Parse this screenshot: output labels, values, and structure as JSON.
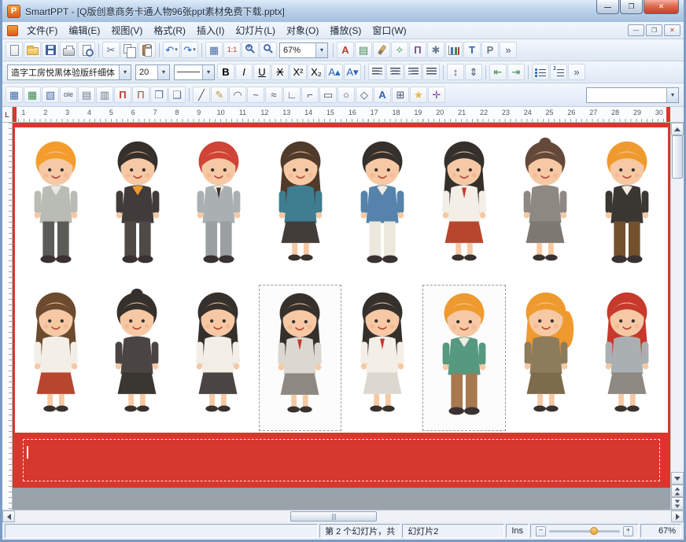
{
  "window": {
    "title": "SmartPPT - [Q版创意商务卡通人物96张ppt素材免费下载.pptx]"
  },
  "menu": {
    "items": [
      "文件(F)",
      "编辑(E)",
      "视图(V)",
      "格式(R)",
      "插入(I)",
      "幻灯片(L)",
      "对象(O)",
      "播放(S)",
      "窗口(W)"
    ]
  },
  "toolbars": {
    "zoom_combo": "67%",
    "font_combo": "造字工房悦黑体验版纤细体",
    "size_combo": "20",
    "row1_a": [
      {
        "name": "new-document-icon",
        "cls": "ic-page"
      },
      {
        "name": "open-folder-icon",
        "cls": "ic-folder"
      },
      {
        "name": "save-icon",
        "cls": "ic-disk"
      },
      {
        "name": "print-icon",
        "cls": "ic-print"
      },
      {
        "name": "print-preview-icon",
        "cls": "ic-preview"
      },
      {
        "sep": true
      },
      {
        "name": "cut-icon",
        "glyph": "✂",
        "color": "#5a6b7d"
      },
      {
        "name": "copy-icon",
        "cls": "ic-copy"
      },
      {
        "name": "paste-icon",
        "cls": "ic-paste"
      },
      {
        "sep": true
      },
      {
        "name": "undo-icon",
        "glyph": "↶",
        "color": "#2a62b8",
        "caret": true
      },
      {
        "name": "redo-icon",
        "glyph": "↷",
        "color": "#2a62b8",
        "caret": true
      },
      {
        "sep": true
      },
      {
        "name": "insert-table-icon",
        "glyph": "▦",
        "color": "#4a6ea8"
      },
      {
        "name": "actual-size-icon",
        "text": "1:1",
        "color": "#c0392b",
        "small": true
      },
      {
        "name": "zoom-in-icon",
        "cls": "ic-mag plus"
      },
      {
        "name": "zoom-icon",
        "cls": "ic-mag"
      }
    ],
    "row1_b": [
      {
        "sep": true
      },
      {
        "name": "font-color-icon",
        "text": "A",
        "color": "#c0392b",
        "bold": true
      },
      {
        "name": "slide-design-icon",
        "glyph": "▤",
        "color": "#3f8a4f"
      },
      {
        "name": "format-brush-icon",
        "cls": "ic-brush"
      },
      {
        "name": "clear-format-icon",
        "glyph": "✧",
        "color": "#3f8a4f"
      },
      {
        "name": "formula-icon",
        "text": "Π",
        "color": "#7a4a9a",
        "bold": true
      },
      {
        "name": "tools-icon",
        "glyph": "✱",
        "color": "#6b7b8d"
      },
      {
        "name": "chart-icon",
        "cls": "ic-chart"
      },
      {
        "name": "textbox-icon",
        "text": "T",
        "color": "#2a62b8",
        "bold": true
      },
      {
        "name": "placeholder-icon",
        "text": "P",
        "color": "#6b7b8d",
        "bold": true
      },
      {
        "name": "more-buttons-icon",
        "text": "»",
        "color": "#44526b"
      }
    ],
    "row2": [
      {
        "name": "bold-icon",
        "text": "B",
        "bold": true
      },
      {
        "name": "italic-icon",
        "text": "I",
        "italic": true
      },
      {
        "name": "underline-icon",
        "text": "U",
        "underline": true
      },
      {
        "name": "strikethrough-icon",
        "text": "X",
        "strike": true
      },
      {
        "name": "superscript-icon",
        "text": "X²"
      },
      {
        "name": "subscript-icon",
        "text": "X₂"
      },
      {
        "name": "increase-font-icon",
        "text": "A▴",
        "color": "#2a62b8"
      },
      {
        "name": "decrease-font-icon",
        "text": "A▾",
        "color": "#2a62b8"
      },
      {
        "sep": true
      },
      {
        "name": "align-left-icon",
        "cls": "ic-al l"
      },
      {
        "name": "align-center-icon",
        "cls": "ic-al c"
      },
      {
        "name": "align-right-icon",
        "cls": "ic-al r"
      },
      {
        "name": "align-justify-icon",
        "cls": "ic-al"
      },
      {
        "sep": true
      },
      {
        "name": "line-spacing-icon",
        "glyph": "↕",
        "color": "#44526b"
      },
      {
        "name": "paragraph-spacing-icon",
        "glyph": "⇕",
        "color": "#44526b"
      },
      {
        "sep": true
      },
      {
        "name": "decrease-indent-icon",
        "glyph": "⇤",
        "color": "#3f8a4f"
      },
      {
        "name": "increase-indent-icon",
        "glyph": "⇥",
        "color": "#3f8a4f"
      },
      {
        "sep": true
      },
      {
        "name": "bullets-icon",
        "cls": "ic-bul"
      },
      {
        "name": "numbering-icon",
        "cls": "ic-num"
      },
      {
        "name": "more-format-icon",
        "text": "»",
        "color": "#44526b"
      }
    ],
    "row3": [
      {
        "name": "insert-table-grid-icon",
        "glyph": "▦",
        "color": "#4a6ea8"
      },
      {
        "name": "table-borders-icon",
        "glyph": "▦",
        "color": "#3f8a4f"
      },
      {
        "name": "table-shading-icon",
        "glyph": "▧",
        "color": "#4a6ea8"
      },
      {
        "name": "ole-object-icon",
        "text": "ole",
        "small": true,
        "color": "#44526b"
      },
      {
        "name": "worksheet-icon",
        "glyph": "▤",
        "color": "#6b7b8d"
      },
      {
        "name": "matrix-icon",
        "glyph": "▥",
        "color": "#6b7b8d"
      },
      {
        "name": "formula-pi-icon",
        "text": "Π",
        "color": "#c0392b",
        "bold": true
      },
      {
        "name": "formula-pi-2-icon",
        "text": "Π",
        "color": "#c0392b"
      },
      {
        "name": "frame-icon",
        "glyph": "❐",
        "color": "#4a6ea8"
      },
      {
        "name": "frame-2-icon",
        "glyph": "❑",
        "color": "#4a6ea8"
      },
      {
        "sep": true
      },
      {
        "name": "line-tool-icon",
        "glyph": "╱",
        "color": "#44526b"
      },
      {
        "name": "pencil-tool-icon",
        "glyph": "✎",
        "color": "#b8923c"
      },
      {
        "name": "arc-tool-icon",
        "glyph": "◠",
        "color": "#44526b"
      },
      {
        "name": "curve-tool-icon",
        "glyph": "~",
        "color": "#44526b"
      },
      {
        "name": "freeform-tool-icon",
        "glyph": "≈",
        "color": "#44526b"
      },
      {
        "name": "connector-icon",
        "glyph": "∟",
        "color": "#44526b"
      },
      {
        "name": "elbow-connector-icon",
        "glyph": "⌐",
        "color": "#44526b"
      },
      {
        "name": "rectangle-tool-icon",
        "glyph": "▭",
        "color": "#44526b"
      },
      {
        "name": "ellipse-tool-icon",
        "glyph": "○",
        "color": "#44526b"
      },
      {
        "name": "polygon-tool-icon",
        "glyph": "◇",
        "color": "#44526b"
      },
      {
        "name": "wordart-icon",
        "text": "A",
        "color": "#2a62b8",
        "bold": true
      },
      {
        "name": "crop-icon",
        "glyph": "⊞",
        "color": "#44526b"
      },
      {
        "name": "star-tool-icon",
        "glyph": "★",
        "color": "#e8b64c"
      },
      {
        "name": "select-tool-icon",
        "glyph": "✛",
        "color": "#7a4a9a"
      }
    ]
  },
  "ruler": {
    "numbers": [
      "1",
      "2",
      "3",
      "4",
      "5",
      "6",
      "7",
      "8",
      "9",
      "10",
      "11",
      "12",
      "13",
      "14",
      "15",
      "16",
      "17",
      "18",
      "19",
      "20",
      "21",
      "22",
      "23",
      "24",
      "25",
      "26",
      "27",
      "28",
      "29",
      "30"
    ]
  },
  "slide": {
    "accent_red": "#d6382d",
    "characters": [
      {
        "g": "m",
        "hair": "#f59d2c",
        "top": "#b9bcb4",
        "shirt": "#ece9e1",
        "bottom": "#5b5b57"
      },
      {
        "g": "m",
        "hair": "#35302c",
        "top": "#413c3a",
        "shirt": "#ef9a2e",
        "bottom": "#504a47"
      },
      {
        "g": "m",
        "hair": "#cf4436",
        "top": "#aab0b2",
        "shirt": "#f1ede5",
        "accent": "#3a3632",
        "bottom": "#9aa0a2"
      },
      {
        "g": "f",
        "hair": "#503a2a",
        "top": "#3f7d90",
        "bottom": "#433d3a"
      },
      {
        "g": "m",
        "hair": "#35302c",
        "top": "#5583ab",
        "shirt": "#f1ede5",
        "bottom": "#ece8de"
      },
      {
        "g": "f",
        "hair": "#35302c",
        "top": "#f3efe7",
        "accent": "#c6392c",
        "bottom": "#b8462f"
      },
      {
        "g": "f",
        "style": "bun",
        "hair": "#64493a",
        "top": "#8d8882",
        "bottom": "#7d7872"
      },
      {
        "g": "m",
        "hair": "#ef9a2e",
        "top": "#3a3632",
        "shirt": "#f1ede5",
        "bottom": "#74512d"
      },
      {
        "g": "f",
        "hair": "#6b4a2e",
        "top": "#f3efe7",
        "bottom": "#b8462f"
      },
      {
        "g": "f",
        "style": "bun",
        "hair": "#35302c",
        "top": "#4a4542",
        "bottom": "#3a3632"
      },
      {
        "g": "f",
        "hair": "#35302c",
        "top": "#f3efe7",
        "bottom": "#4a4542"
      },
      {
        "g": "f",
        "hair": "#35302c",
        "top": "#dcd8d0",
        "accent": "#c6392c",
        "bottom": "#8d8882",
        "selected": true
      },
      {
        "g": "f",
        "hair": "#35302c",
        "top": "#f3efe7",
        "accent": "#c6392c",
        "bottom": "#dcd8d0"
      },
      {
        "g": "m",
        "hair": "#ef9a2e",
        "top": "#55997e",
        "shirt": "#f1ede5",
        "bottom": "#a8784e",
        "selected": true
      },
      {
        "g": "f",
        "style": "pony",
        "hair": "#ef9a2e",
        "top": "#8d7c5c",
        "bottom": "#7d6c4c"
      },
      {
        "g": "f",
        "hair": "#c6392c",
        "top": "#aab0b2",
        "bottom": "#8d8882"
      }
    ]
  },
  "statusbar": {
    "slide_info": "第 2 个幻灯片，共",
    "slide_label": "幻灯片2",
    "ins": "Ins",
    "zoom": "67%"
  }
}
